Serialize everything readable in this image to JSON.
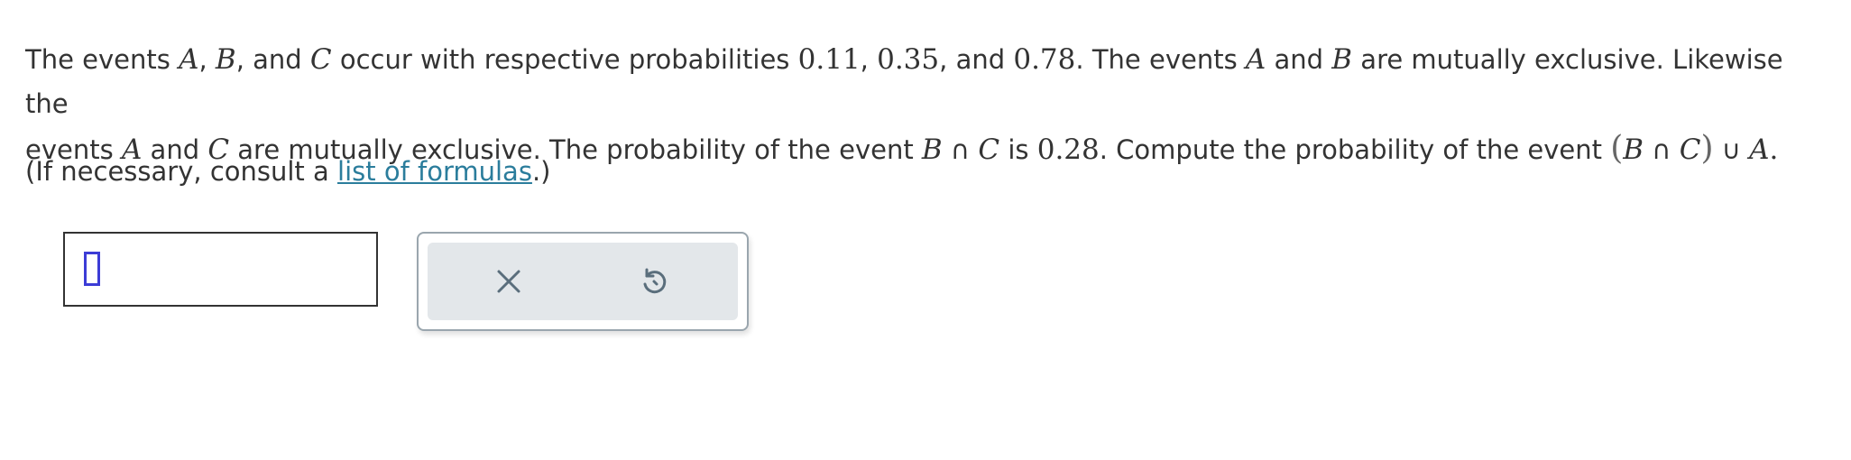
{
  "problem": {
    "l1_a": "The events ",
    "var_A": "A",
    "comma1": ", ",
    "var_B": "B",
    "l1_b": ", and ",
    "var_C": "C",
    "l1_c": " occur with respective probabilities ",
    "p_A": "0.11",
    "comma2": ", ",
    "p_B": "0.35",
    "l1_d": ", and ",
    "p_C": "0.78",
    "l1_e": ". The events ",
    "l1_f": " and ",
    "l1_g": " are mutually exclusive. Likewise the",
    "l2_a": "events ",
    "l2_b": " and ",
    "l2_c": " are mutually exclusive. The probability of the event ",
    "cap": "∩",
    "l2_d": " is ",
    "p_BC": "0.28",
    "l2_e": ". Compute the probability of the event ",
    "lparen": "(",
    "rparen": ")",
    "cup": "∪",
    "period": "."
  },
  "consult": {
    "before": "(If necessary, consult a ",
    "link": "list of formulas",
    "after": ".)"
  },
  "answer": {
    "value": ""
  },
  "tools": {
    "clear_icon": "x-icon",
    "undo_icon": "undo-icon",
    "icon_color": "#5a6e7c"
  },
  "colors": {
    "link": "#2b7d9c",
    "caret": "#3c3cd6",
    "text": "#333333"
  }
}
